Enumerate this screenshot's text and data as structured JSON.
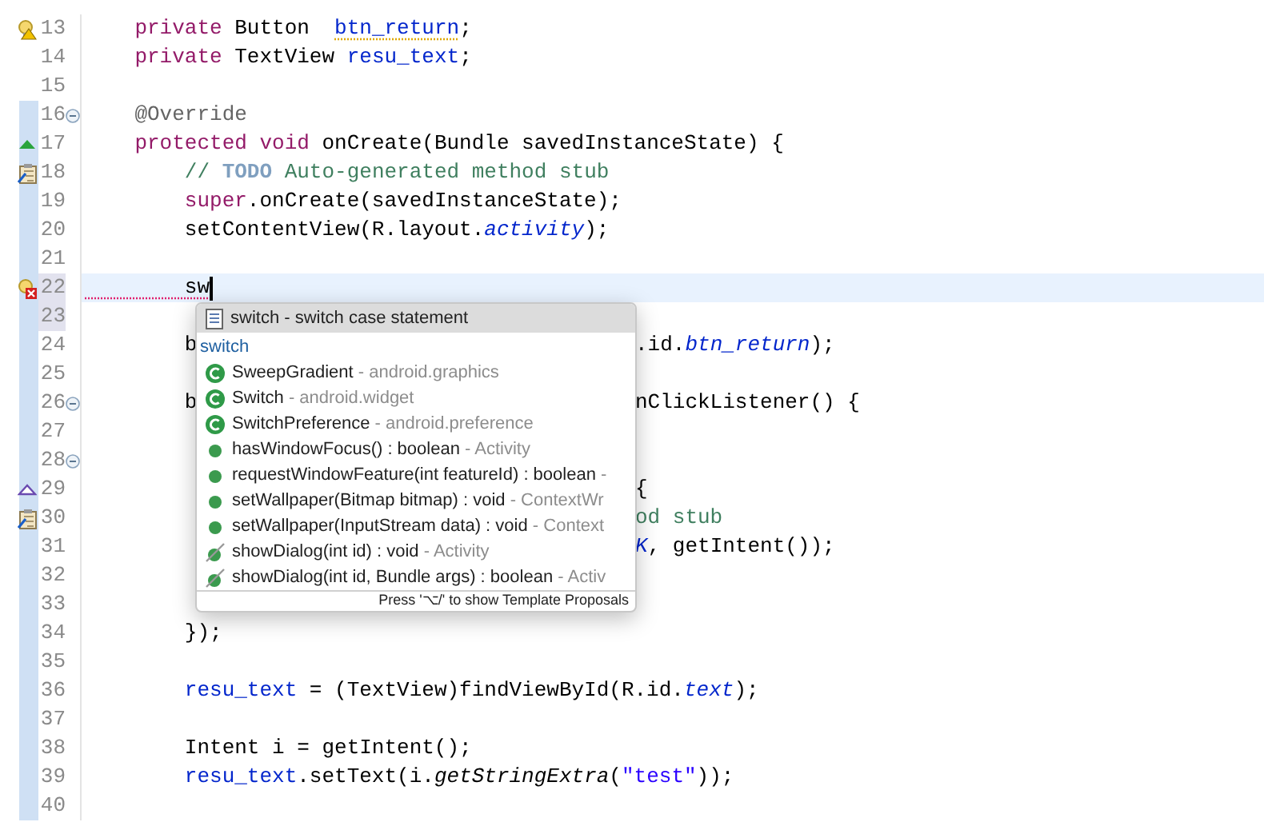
{
  "editor": {
    "lines": [
      {
        "number": "13",
        "marker": {
          "kind": "warning"
        },
        "code": [
          {
            "text": "    private",
            "kind": "keyword"
          },
          {
            "text": " Button  "
          },
          {
            "text": "btn_return",
            "kind": "warning-field"
          },
          {
            "text": ";"
          }
        ]
      },
      {
        "number": "14",
        "code": [
          {
            "text": "    private",
            "kind": "keyword"
          },
          {
            "text": " TextView "
          },
          {
            "text": "resu_text",
            "kind": "field"
          },
          {
            "text": ";"
          }
        ]
      },
      {
        "number": "15"
      },
      {
        "number": "16",
        "range": true,
        "fold": true,
        "code": [
          {
            "text": "    @Override",
            "kind": "annotation"
          }
        ]
      },
      {
        "number": "17",
        "range": true,
        "marker": {
          "kind": "override"
        },
        "code": [
          {
            "text": "    protected",
            "kind": "keyword"
          },
          {
            "text": " void",
            "kind": "keyword"
          },
          {
            "text": " onCreate(Bundle savedInstanceState) {"
          }
        ]
      },
      {
        "number": "18",
        "range": true,
        "marker": {
          "kind": "task"
        },
        "code": [
          {
            "text": "        //",
            "kind": "comment"
          },
          {
            "text": " TODO",
            "kind": "todo"
          },
          {
            "text": " Auto-generated method stub",
            "kind": "comment"
          }
        ]
      },
      {
        "number": "19",
        "range": true,
        "code": [
          {
            "text": "        super",
            "kind": "keyword"
          },
          {
            "text": ".onCreate(savedInstanceState);"
          }
        ]
      },
      {
        "number": "20",
        "range": true,
        "code": [
          {
            "text": "        setContentView(R.layout."
          },
          {
            "text": "activity",
            "kind": "static"
          },
          {
            "text": ");"
          }
        ]
      },
      {
        "number": "21",
        "range": true
      },
      {
        "number": "22",
        "range": true,
        "marker": {
          "kind": "error"
        },
        "current": true,
        "number_highlight": true,
        "code": [
          {
            "text": "        sw",
            "kind": "error-text"
          }
        ]
      },
      {
        "number": "23",
        "range": true,
        "number_highlight": true
      },
      {
        "number": "24",
        "range": true,
        "code": [
          {
            "text": "        b"
          }
        ],
        "after_popup": [
          {
            "text": ".id."
          },
          {
            "text": "btn_return",
            "kind": "static"
          },
          {
            "text": ");"
          }
        ]
      },
      {
        "number": "25",
        "range": true
      },
      {
        "number": "26",
        "range": true,
        "fold": true,
        "code": [
          {
            "text": "        b"
          }
        ],
        "after_popup": [
          {
            "text": "nClickListener() {"
          }
        ]
      },
      {
        "number": "27",
        "range": true
      },
      {
        "number": "28",
        "range": true,
        "fold": true
      },
      {
        "number": "29",
        "range": true,
        "marker": {
          "kind": "implements"
        },
        "after_popup": [
          {
            "text": "{"
          }
        ]
      },
      {
        "number": "30",
        "range": true,
        "marker": {
          "kind": "task"
        },
        "after_popup": [
          {
            "text": "od stub",
            "kind": "comment"
          }
        ]
      },
      {
        "number": "31",
        "range": true,
        "after_popup": [
          {
            "text": "K",
            "kind": "static"
          },
          {
            "text": ", getIntent());"
          }
        ]
      },
      {
        "number": "32",
        "range": true
      },
      {
        "number": "33",
        "range": true
      },
      {
        "number": "34",
        "range": true,
        "code": [
          {
            "text": "        });"
          }
        ]
      },
      {
        "number": "35",
        "range": true
      },
      {
        "number": "36",
        "range": true,
        "code": [
          {
            "text": "        resu_text",
            "kind": "field"
          },
          {
            "text": " = (TextView)findViewById(R.id."
          },
          {
            "text": "text",
            "kind": "static"
          },
          {
            "text": ");"
          }
        ]
      },
      {
        "number": "37",
        "range": true
      },
      {
        "number": "38",
        "range": true,
        "code": [
          {
            "text": "        Intent i = getIntent();"
          }
        ]
      },
      {
        "number": "39",
        "range": true,
        "code": [
          {
            "text": "        resu_text",
            "kind": "field"
          },
          {
            "text": ".setText(i."
          },
          {
            "text": "getStringExtra",
            "kind": "italic"
          },
          {
            "text": "("
          },
          {
            "text": "\"test\"",
            "kind": "string"
          },
          {
            "text": "));"
          }
        ]
      },
      {
        "number": "40",
        "range": true
      }
    ]
  },
  "completion_popup": {
    "proposals": [
      {
        "kind": "template",
        "selected": true,
        "label": "switch - switch case statement"
      },
      {
        "kind": "keyword",
        "selected": false,
        "label": "switch"
      },
      {
        "kind": "class",
        "selected": false,
        "label": "SweepGradient",
        "qualifier": "- android.graphics"
      },
      {
        "kind": "class",
        "selected": false,
        "label": "Switch",
        "qualifier": "- android.widget"
      },
      {
        "kind": "class",
        "selected": false,
        "label": "SwitchPreference",
        "qualifier": "- android.preference"
      },
      {
        "kind": "method",
        "selected": false,
        "label": "hasWindowFocus() : boolean",
        "qualifier": "- Activity"
      },
      {
        "kind": "method",
        "selected": false,
        "label": "requestWindowFeature(int featureId) : boolean",
        "qualifier": "-"
      },
      {
        "kind": "method",
        "selected": false,
        "label": "setWallpaper(Bitmap bitmap) : void",
        "qualifier": "- ContextWr"
      },
      {
        "kind": "method",
        "selected": false,
        "label": "setWallpaper(InputStream data) : void",
        "qualifier": "- Context"
      },
      {
        "kind": "deprecated",
        "selected": false,
        "label": "showDialog(int id) : void",
        "qualifier": "- Activity"
      },
      {
        "kind": "deprecated",
        "selected": false,
        "label": "showDialog(int id, Bundle args) : boolean",
        "qualifier": "- Activ"
      }
    ],
    "hint": "Press '⌥/' to show Template Proposals"
  }
}
